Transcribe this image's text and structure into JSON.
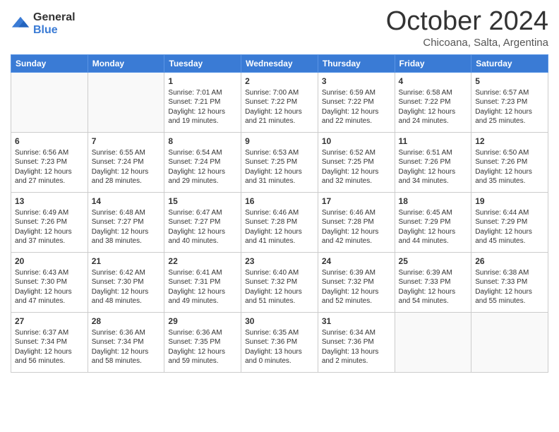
{
  "logo": {
    "general": "General",
    "blue": "Blue"
  },
  "title": "October 2024",
  "subtitle": "Chicoana, Salta, Argentina",
  "weekdays": [
    "Sunday",
    "Monday",
    "Tuesday",
    "Wednesday",
    "Thursday",
    "Friday",
    "Saturday"
  ],
  "weeks": [
    [
      {
        "num": "",
        "info": ""
      },
      {
        "num": "",
        "info": ""
      },
      {
        "num": "1",
        "info": "Sunrise: 7:01 AM\nSunset: 7:21 PM\nDaylight: 12 hours and 19 minutes."
      },
      {
        "num": "2",
        "info": "Sunrise: 7:00 AM\nSunset: 7:22 PM\nDaylight: 12 hours and 21 minutes."
      },
      {
        "num": "3",
        "info": "Sunrise: 6:59 AM\nSunset: 7:22 PM\nDaylight: 12 hours and 22 minutes."
      },
      {
        "num": "4",
        "info": "Sunrise: 6:58 AM\nSunset: 7:22 PM\nDaylight: 12 hours and 24 minutes."
      },
      {
        "num": "5",
        "info": "Sunrise: 6:57 AM\nSunset: 7:23 PM\nDaylight: 12 hours and 25 minutes."
      }
    ],
    [
      {
        "num": "6",
        "info": "Sunrise: 6:56 AM\nSunset: 7:23 PM\nDaylight: 12 hours and 27 minutes."
      },
      {
        "num": "7",
        "info": "Sunrise: 6:55 AM\nSunset: 7:24 PM\nDaylight: 12 hours and 28 minutes."
      },
      {
        "num": "8",
        "info": "Sunrise: 6:54 AM\nSunset: 7:24 PM\nDaylight: 12 hours and 29 minutes."
      },
      {
        "num": "9",
        "info": "Sunrise: 6:53 AM\nSunset: 7:25 PM\nDaylight: 12 hours and 31 minutes."
      },
      {
        "num": "10",
        "info": "Sunrise: 6:52 AM\nSunset: 7:25 PM\nDaylight: 12 hours and 32 minutes."
      },
      {
        "num": "11",
        "info": "Sunrise: 6:51 AM\nSunset: 7:26 PM\nDaylight: 12 hours and 34 minutes."
      },
      {
        "num": "12",
        "info": "Sunrise: 6:50 AM\nSunset: 7:26 PM\nDaylight: 12 hours and 35 minutes."
      }
    ],
    [
      {
        "num": "13",
        "info": "Sunrise: 6:49 AM\nSunset: 7:26 PM\nDaylight: 12 hours and 37 minutes."
      },
      {
        "num": "14",
        "info": "Sunrise: 6:48 AM\nSunset: 7:27 PM\nDaylight: 12 hours and 38 minutes."
      },
      {
        "num": "15",
        "info": "Sunrise: 6:47 AM\nSunset: 7:27 PM\nDaylight: 12 hours and 40 minutes."
      },
      {
        "num": "16",
        "info": "Sunrise: 6:46 AM\nSunset: 7:28 PM\nDaylight: 12 hours and 41 minutes."
      },
      {
        "num": "17",
        "info": "Sunrise: 6:46 AM\nSunset: 7:28 PM\nDaylight: 12 hours and 42 minutes."
      },
      {
        "num": "18",
        "info": "Sunrise: 6:45 AM\nSunset: 7:29 PM\nDaylight: 12 hours and 44 minutes."
      },
      {
        "num": "19",
        "info": "Sunrise: 6:44 AM\nSunset: 7:29 PM\nDaylight: 12 hours and 45 minutes."
      }
    ],
    [
      {
        "num": "20",
        "info": "Sunrise: 6:43 AM\nSunset: 7:30 PM\nDaylight: 12 hours and 47 minutes."
      },
      {
        "num": "21",
        "info": "Sunrise: 6:42 AM\nSunset: 7:30 PM\nDaylight: 12 hours and 48 minutes."
      },
      {
        "num": "22",
        "info": "Sunrise: 6:41 AM\nSunset: 7:31 PM\nDaylight: 12 hours and 49 minutes."
      },
      {
        "num": "23",
        "info": "Sunrise: 6:40 AM\nSunset: 7:32 PM\nDaylight: 12 hours and 51 minutes."
      },
      {
        "num": "24",
        "info": "Sunrise: 6:39 AM\nSunset: 7:32 PM\nDaylight: 12 hours and 52 minutes."
      },
      {
        "num": "25",
        "info": "Sunrise: 6:39 AM\nSunset: 7:33 PM\nDaylight: 12 hours and 54 minutes."
      },
      {
        "num": "26",
        "info": "Sunrise: 6:38 AM\nSunset: 7:33 PM\nDaylight: 12 hours and 55 minutes."
      }
    ],
    [
      {
        "num": "27",
        "info": "Sunrise: 6:37 AM\nSunset: 7:34 PM\nDaylight: 12 hours and 56 minutes."
      },
      {
        "num": "28",
        "info": "Sunrise: 6:36 AM\nSunset: 7:34 PM\nDaylight: 12 hours and 58 minutes."
      },
      {
        "num": "29",
        "info": "Sunrise: 6:36 AM\nSunset: 7:35 PM\nDaylight: 12 hours and 59 minutes."
      },
      {
        "num": "30",
        "info": "Sunrise: 6:35 AM\nSunset: 7:36 PM\nDaylight: 13 hours and 0 minutes."
      },
      {
        "num": "31",
        "info": "Sunrise: 6:34 AM\nSunset: 7:36 PM\nDaylight: 13 hours and 2 minutes."
      },
      {
        "num": "",
        "info": ""
      },
      {
        "num": "",
        "info": ""
      }
    ]
  ]
}
